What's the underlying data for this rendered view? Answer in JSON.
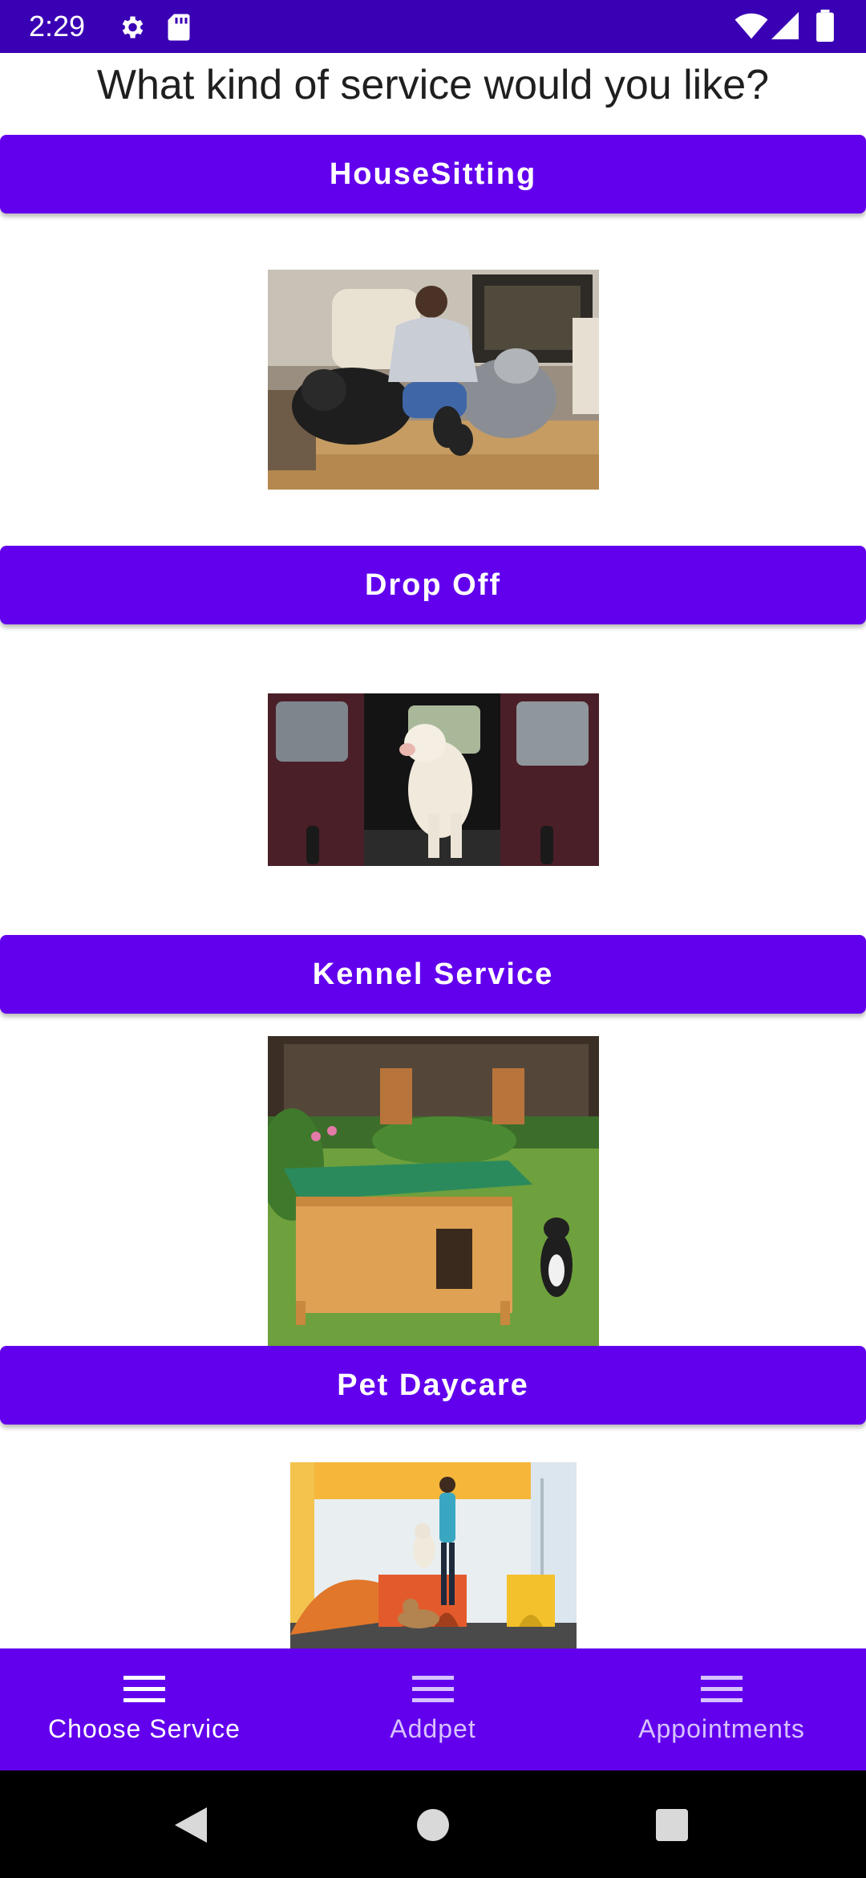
{
  "status_bar": {
    "time": "2:29",
    "icons": [
      "gear-icon",
      "sd-card-icon",
      "wifi-icon",
      "signal-icon",
      "battery-icon"
    ],
    "background": "#3a00b4"
  },
  "page": {
    "title": "What kind of service would you like?"
  },
  "services": [
    {
      "label": "HouseSitting",
      "image": "person-with-dogs-photo"
    },
    {
      "label": "Drop Off",
      "image": "dog-in-car-photo"
    },
    {
      "label": "Kennel Service",
      "image": "dog-kennel-photo"
    },
    {
      "label": "Pet Daycare",
      "image": "daycare-dogs-photo"
    }
  ],
  "bottom_nav": {
    "items": [
      {
        "label": "Choose Service",
        "icon": "menu-icon",
        "active": true
      },
      {
        "label": "Addpet",
        "icon": "menu-icon",
        "active": false
      },
      {
        "label": "Appointments",
        "icon": "menu-icon",
        "active": false
      }
    ]
  },
  "colors": {
    "accent": "#6200ee",
    "status_bar": "#3a00b4",
    "inactive_nav_text": "#d7c2ff"
  },
  "system_nav": {
    "icons": [
      "back-icon",
      "home-icon",
      "recents-icon"
    ]
  }
}
